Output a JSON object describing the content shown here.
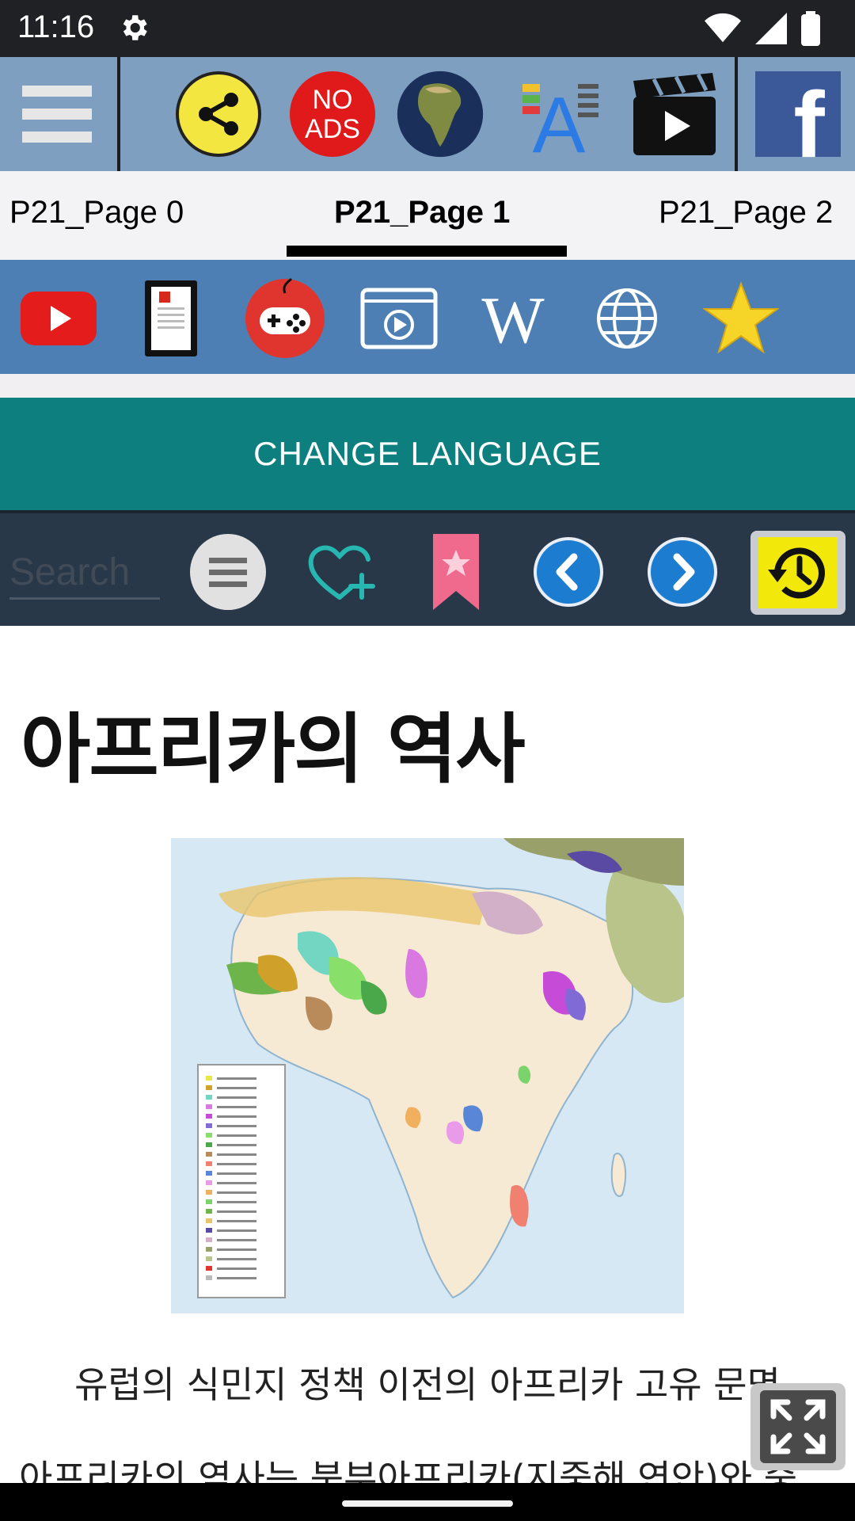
{
  "status_bar": {
    "time": "11:16"
  },
  "tabs": [
    {
      "label": "P21_Page 0"
    },
    {
      "label": "P21_Page 1"
    },
    {
      "label": "P21_Page 2"
    }
  ],
  "top_toolbar": {
    "no_ads_line1": "NO",
    "no_ads_line2": "ADS",
    "font_icon_letter": "A",
    "facebook_letter": "f"
  },
  "app_bar": {
    "wiki_letter": "W"
  },
  "change_language": {
    "label": "CHANGE LANGUAGE"
  },
  "search": {
    "placeholder": "Search"
  },
  "article": {
    "title": "아프리카의 역사",
    "caption": "유럽의 식민지 정책 이전의 아프리카 고유 문명",
    "body": "아프리카의 역사는 북부아프리카(지중해 연안)와 중"
  },
  "colors": {
    "status_bar": "#202124",
    "top_toolbar": "#7e9fbf",
    "app_bar": "#4d7fb4",
    "accent_teal": "#0e7f7f",
    "nav_toolbar": "#283849"
  }
}
